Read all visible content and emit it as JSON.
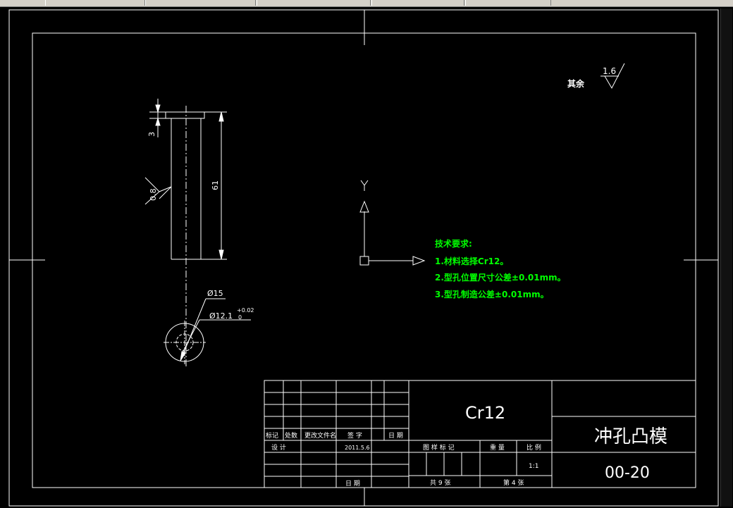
{
  "drawing": {
    "roughness_general": "其余",
    "roughness_general_value": "1.6",
    "dims": {
      "head_height": "3",
      "length": "61",
      "roughness_side": "0.8",
      "dia_outer": "Ø15",
      "dia_inner": "Ø12.1",
      "tol_upper": "+0.02",
      "tol_lower": "0"
    },
    "ucs_label": "Y",
    "tech_notes": {
      "title": "技术要求:",
      "lines": [
        "1.材料选择Cr12。",
        "2.型孔位置尺寸公差±0.01mm。",
        "3.型孔制造公差±0.01mm。"
      ]
    },
    "colors": {
      "notes": "#00ff00",
      "lines": "#ffffff",
      "background": "#000000"
    }
  },
  "title_block": {
    "material": "Cr12",
    "part_name": "冲孔凸模",
    "drawing_no": "00-20",
    "labels": {
      "mark": "标记",
      "count": "处数",
      "change_doc": "更改文件名",
      "signature": "签 字",
      "date": "日 期",
      "design": "设 计",
      "design_date": "2011.5.6",
      "stage_mark": "图 样 标 记",
      "weight": "重 量",
      "scale": "比 例",
      "scale_value": "1:1",
      "date2": "日 期",
      "total_sheets": "共 9 张",
      "sheet_no": "第 4 张"
    }
  }
}
